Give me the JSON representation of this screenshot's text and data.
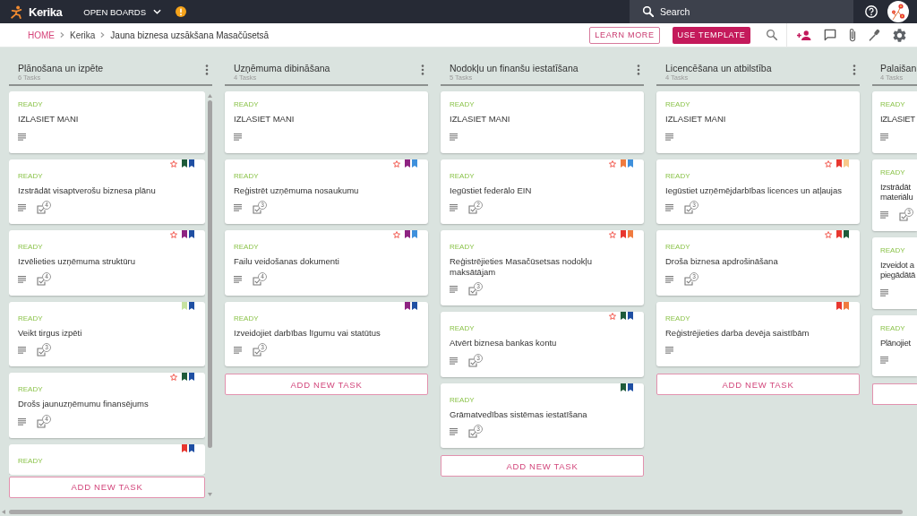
{
  "top_bar": {
    "logo_text": "Kerika",
    "open_boards": "OPEN BOARDS",
    "search": {
      "placeholder": "Search"
    }
  },
  "breadcrumb": [
    {
      "label": "HOME",
      "kind": "home"
    },
    {
      "label": "Kerika",
      "kind": "link"
    },
    {
      "label": "Jauna biznesa uzsākšana Masačūsetsā",
      "kind": "current"
    }
  ],
  "actions": [
    {
      "label": "LEARN MORE",
      "kind": "outline"
    },
    {
      "label": "USE TEMPLATE",
      "kind": "filled"
    }
  ],
  "columns": [
    {
      "title": "Plānošana un izpēte",
      "count": "6 Tasks",
      "scrollable": true,
      "cut_off": false,
      "add_button": "ADD NEW TASK",
      "cards": [
        {
          "status": "READY",
          "title": "IZLASIET MANI",
          "starred": false,
          "description": true
        },
        {
          "status": "READY",
          "title": "Izstrādāt visaptverošu biznesa plānu",
          "starred": true,
          "labels": [
            {
              "color": "#1e5b3a"
            },
            {
              "color": "#1f4fa3"
            }
          ],
          "description": true,
          "checklist": "4"
        },
        {
          "status": "READY",
          "title": "Izvēlieties uzņēmuma struktūru",
          "starred": true,
          "labels": [
            {
              "color": "#8e2382"
            },
            {
              "color": "#1f4fa3"
            }
          ],
          "description": true,
          "checklist": "4"
        },
        {
          "status": "READY",
          "title": "Veikt tirgus izpēti",
          "starred": false,
          "labels": [
            {
              "color": "#c6e2a0"
            },
            {
              "color": "#1f4fa3"
            }
          ],
          "description": true,
          "checklist": "3"
        },
        {
          "status": "READY",
          "title": "Drošs jaunuzņēmumu finansējums",
          "starred": true,
          "labels": [
            {
              "color": "#1e5b3a"
            },
            {
              "color": "#1f4fa3"
            }
          ],
          "description": true,
          "checklist": "4"
        },
        {
          "status": "READY",
          "starred": false,
          "labels": [
            {
              "color": "#e8372f"
            },
            {
              "color": "#1f4fa3"
            }
          ]
        }
      ]
    },
    {
      "title": "Uzņēmuma dibināšana",
      "count": "4 Tasks",
      "scrollable": false,
      "cut_off": false,
      "add_button": "ADD NEW TASK",
      "cards": [
        {
          "status": "READY",
          "title": "IZLASIET MANI",
          "starred": false,
          "description": true
        },
        {
          "status": "READY",
          "title": "Reģistrēt uzņēmuma nosaukumu",
          "starred": true,
          "labels": [
            {
              "color": "#8e2382"
            },
            {
              "color": "#3f90dc"
            }
          ],
          "description": true,
          "checklist": "3"
        },
        {
          "status": "READY",
          "title": "Failu veidošanas dokumenti",
          "starred": true,
          "labels": [
            {
              "color": "#8e2382"
            },
            {
              "color": "#3f90dc"
            }
          ],
          "description": true,
          "checklist": "4"
        },
        {
          "status": "READY",
          "title": "Izveidojiet darbības līgumu vai statūtus",
          "starred": false,
          "labels": [
            {
              "color": "#8e2382"
            },
            {
              "color": "#1f4fa3"
            }
          ],
          "description": true,
          "checklist": "3"
        }
      ]
    },
    {
      "title": "Nodokļu un finanšu iestatīšana",
      "count": "5 Tasks",
      "scrollable": false,
      "cut_off": false,
      "add_button": "ADD NEW TASK",
      "cards": [
        {
          "status": "READY",
          "title": "IZLASIET MANI",
          "starred": false,
          "description": true
        },
        {
          "status": "READY",
          "title": "Iegūstiet federālo EIN",
          "starred": true,
          "labels": [
            {
              "color": "#f07b3f"
            },
            {
              "color": "#3f90dc"
            }
          ],
          "description": true,
          "checklist": "2"
        },
        {
          "status": "READY",
          "title": "Reģistrējieties Masačūsetsas nodokļu maksātājam",
          "starred": true,
          "labels": [
            {
              "color": "#e8372f"
            },
            {
              "color": "#f07b3f"
            }
          ],
          "description": true,
          "checklist": "3"
        },
        {
          "status": "READY",
          "title": "Atvērt biznesa bankas kontu",
          "starred": true,
          "labels": [
            {
              "color": "#1e5b3a"
            },
            {
              "color": "#1f4fa3"
            }
          ],
          "description": true,
          "checklist": "3"
        },
        {
          "status": "READY",
          "title": "Grāmatvedības sistēmas iestatīšana",
          "starred": false,
          "labels": [
            {
              "color": "#1e5b3a"
            },
            {
              "color": "#1f4fa3"
            }
          ],
          "description": true,
          "checklist": "3"
        }
      ]
    },
    {
      "title": "Licencēšana un atbilstība",
      "count": "4 Tasks",
      "scrollable": false,
      "cut_off": false,
      "add_button": "ADD NEW TASK",
      "cards": [
        {
          "status": "READY",
          "title": "IZLASIET MANI",
          "starred": false,
          "description": true
        },
        {
          "status": "READY",
          "title": "Iegūstiet uzņēmējdarbības licences un atļaujas",
          "starred": true,
          "labels": [
            {
              "color": "#e8372f"
            },
            {
              "color": "#f7c98b"
            }
          ],
          "description": true,
          "checklist": "3"
        },
        {
          "status": "READY",
          "title": "Droša biznesa apdrošināšana",
          "starred": true,
          "labels": [
            {
              "color": "#e8372f"
            },
            {
              "color": "#1e5b3a"
            }
          ],
          "description": true,
          "checklist": "3"
        },
        {
          "status": "READY",
          "title": "Reģistrējieties darba devēja saistībām",
          "starred": false,
          "labels": [
            {
              "color": "#e8372f"
            },
            {
              "color": "#f07b3f"
            }
          ],
          "description": true
        }
      ]
    },
    {
      "title": "Palaišan",
      "count": "4 Tasks",
      "scrollable": false,
      "cut_off": true,
      "cards": [
        {
          "status": "READY",
          "title": "IZLASIET",
          "description": true
        },
        {
          "status": "READY",
          "title": "Izstrādāt materiālu",
          "description": true,
          "checklist": "3"
        },
        {
          "status": "READY",
          "title": "Izveidot a piegādātā",
          "description": true
        },
        {
          "status": "READY",
          "title": "Plānojiet",
          "description": true
        }
      ]
    }
  ]
}
